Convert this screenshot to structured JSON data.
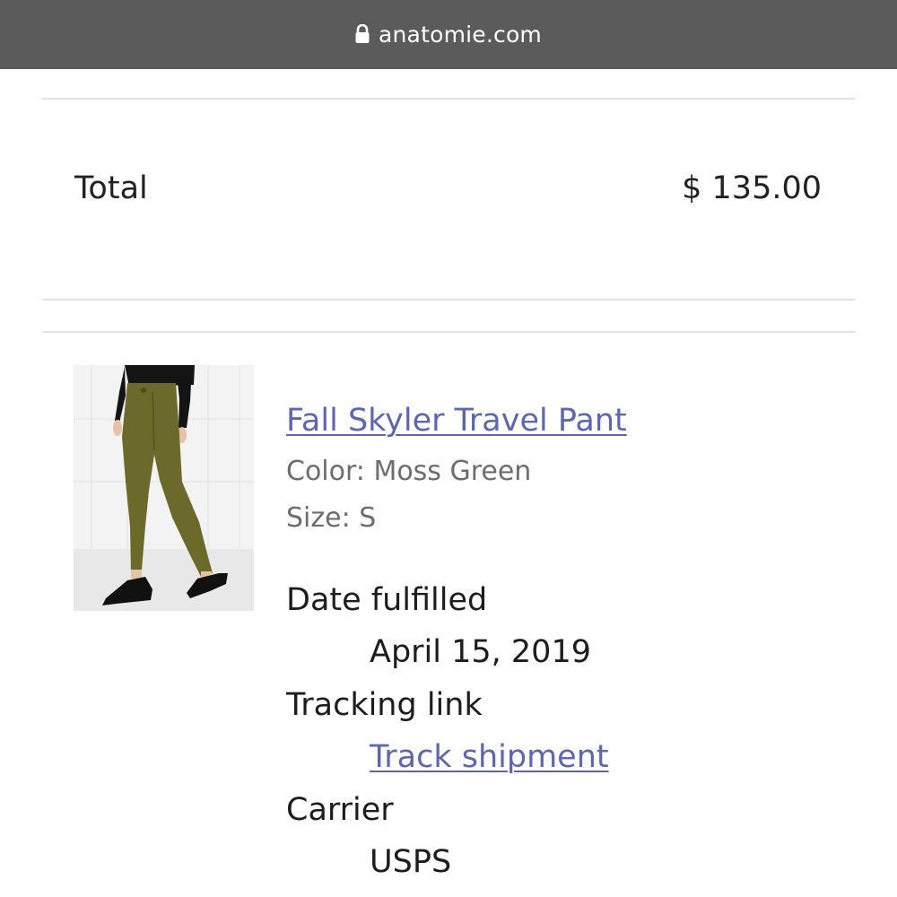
{
  "browser": {
    "domain": "anatomie.com"
  },
  "order": {
    "total_label": "Total",
    "total_value": "$ 135.00"
  },
  "item": {
    "name": "Fall Skyler Travel Pant",
    "color": "Color: Moss Green",
    "size": "Size: S",
    "image_alt": "Fall Skyler Travel Pant in Moss Green"
  },
  "fulfillment": {
    "date_label": "Date fulfilled",
    "date_value": "April 15, 2019",
    "tracking_label": "Tracking link",
    "tracking_value": "Track shipment",
    "carrier_label": "Carrier",
    "carrier_value": "USPS"
  },
  "colors": {
    "url_bar": "#5b5b5b",
    "link": "#5e66ad",
    "pant": "#6b6a2a",
    "divider": "#e2e2e2"
  }
}
